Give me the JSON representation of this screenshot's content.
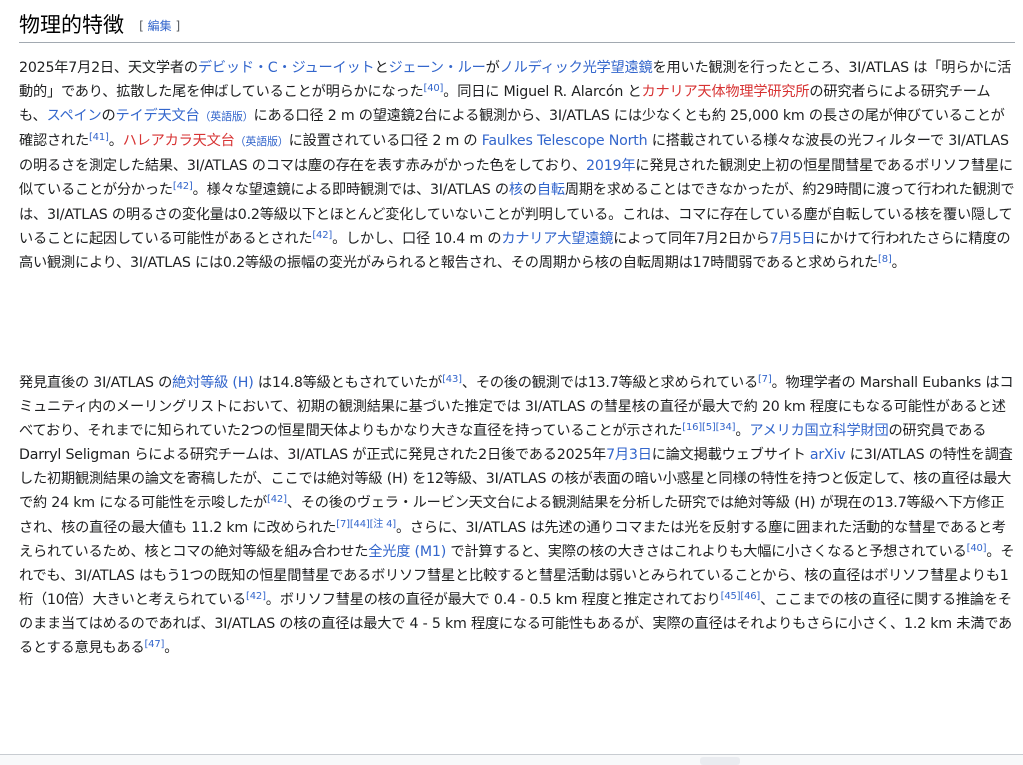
{
  "section": {
    "title": "物理的特徴",
    "edit_open": "[",
    "edit_label": "編集",
    "edit_close": "]"
  },
  "p1": [
    "2025年7月2日、天文学者の",
    "デビッド・C・ジューイット",
    "と",
    "ジェーン・ルー",
    "が",
    "ノルディック光学望遠鏡",
    "を用いた観測を行ったところ、3I/ATLAS は「明らかに活動的」であり、拡散した尾を伸ばしていることが明らかになった",
    "[40]",
    "。同日に Miguel R. Alarcón と",
    "カナリア天体物理学研究所",
    "の研究者らによる研究チームも、",
    "スペイン",
    "の",
    "テイデ天文台",
    "（英語版）",
    "にある口径 2 m の望遠鏡2台による観測から、3I/ATLAS には少なくとも約 25,000 km の長さの尾が伸びていることが確認された",
    "[41]",
    "。",
    "ハレアカラ天文台",
    "（英語版）",
    "に設置されている口径 2 m の ",
    "Faulkes Telescope North",
    " に搭載されている様々な波長の光フィルターで 3I/ATLAS の明るさを測定した結果、3I/ATLAS のコマは塵の存在を表す赤みがかった色をしており、",
    "2019年",
    "に発見された観測史上初の恒星間彗星であるボリソフ彗星に似ていることが分かった",
    "[42]",
    "。様々な望遠鏡による即時観測では、3I/ATLAS の",
    "核",
    "の",
    "自転",
    "周期を求めることはできなかったが、約29時間に渡って行われた観測では、3I/ATLAS の明るさの変化量は0.2等級以下とほとんど変化していないことが判明している。これは、コマに存在している塵が自転している核を覆い隠していることに起因している可能性があるとされた",
    "[42]",
    "。しかし、口径 10.4 m の",
    "カナリア大望遠鏡",
    "によって同年7月2日から",
    "7月5日",
    "にかけて行われたさらに精度の高い観測により、3I/ATLAS には0.2等級の振幅の変光がみられると報告され、その周期から核の自転周期は17時間弱であると求められた",
    "[8]",
    "。"
  ],
  "p2": [
    "発見直後の 3I/ATLAS の",
    "絶対等級 (H)",
    " は14.8等級ともされていたが",
    "[43]",
    "、その後の観測では13.7等級と求められている",
    "[7]",
    "。物理学者の Marshall Eubanks はコミュニティ内のメーリングリストにおいて、初期の観測結果に基づいた推定では 3I/ATLAS の彗星核の直径が最大で約 20 km 程度にもなる可能性があると述べており、それまでに知られていた2つの恒星間天体よりもかなり大きな直径を持っていることが示された",
    "[16]",
    "[5]",
    "[34]",
    "。",
    "アメリカ国立科学財団",
    "の研究員である Darryl Seligman らによる研究チームは、3I/ATLAS が正式に発見された2日後である2025年",
    "7月3日",
    "に論文掲載ウェブサイト ",
    "arXiv",
    " に3I/ATLAS の特性を調査した初期観測結果の論文を寄稿したが、ここでは絶対等級 (H) を12等級、3I/ATLAS の核が表面の暗い小惑星と同様の特性を持つと仮定して、核の直径は最大で約 24 km になる可能性を示唆したが",
    "[42]",
    "、その後のヴェラ・ルービン天文台による観測結果を分析した研究では絶対等級 (H) が現在の13.7等級へ下方修正され、核の直径の最大値も 11.2 km に改められた",
    "[7]",
    "[44]",
    "[注 4]",
    "。さらに、3I/ATLAS は先述の通りコマまたは光を反射する塵に囲まれた活動的な彗星であると考えられているため、核とコマの絶対等級を組み合わせた",
    "全光度 (M1)",
    " で計算すると、実際の核の大きさはこれよりも大幅に小さくなると予想されている",
    "[40]",
    "。それでも、3I/ATLAS はもう1つの既知の恒星間彗星であるボリソフ彗星と比較すると彗星活動は弱いとみられていることから、核の直径はボリソフ彗星よりも1桁（10倍）大きいと考えられている",
    "[42]",
    "。ボリソフ彗星の核の直径が最大で 0.4 - 0.5 km 程度と推定されており",
    "[45]",
    "[46]",
    "、ここまでの核の直径に関する推論をそのまま当てはめるのであれば、3I/ATLAS の核の直径は最大で 4 - 5 km 程度になる可能性もあるが、実際の直径はそれよりもさらに小さく、1.2 km 未満であるとする意見もある",
    "[47]",
    "。"
  ],
  "colors": {
    "link": "#3366cc",
    "redlink": "#d73333",
    "text": "#202122"
  }
}
